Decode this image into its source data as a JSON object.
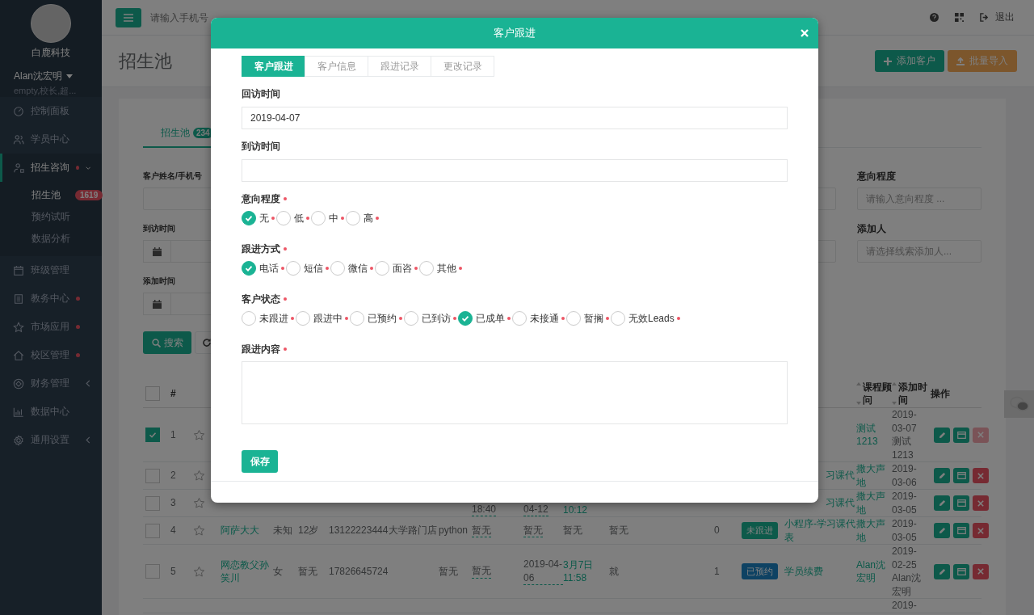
{
  "sidebar": {
    "company": "白鹿科技",
    "user": "Alan沈宏明",
    "roles": "empty,校长,超...",
    "menu": [
      {
        "label": "控制面板",
        "dot": false,
        "selected": false
      },
      {
        "label": "学员中心",
        "dot": false,
        "selected": false
      },
      {
        "label": "招生咨询",
        "dot": true,
        "selected": true,
        "expanded": true,
        "children": [
          {
            "label": "招生池",
            "badge": "1619",
            "selected": true
          },
          {
            "label": "预约试听",
            "selected": false
          },
          {
            "label": "数据分析",
            "selected": false
          }
        ]
      },
      {
        "label": "班级管理",
        "dot": false,
        "selected": false
      },
      {
        "label": "教务中心",
        "dot": true,
        "selected": false
      },
      {
        "label": "市场应用",
        "dot": true,
        "selected": false
      },
      {
        "label": "校区管理",
        "dot": true,
        "selected": false
      },
      {
        "label": "财务管理",
        "dot": false,
        "selected": false,
        "expanded": false
      },
      {
        "label": "数据中心",
        "dot": false,
        "selected": false
      },
      {
        "label": "通用设置",
        "dot": false,
        "selected": false,
        "expanded": false
      }
    ]
  },
  "topbar": {
    "search_placeholder": "请输入手机号",
    "logout": "退出"
  },
  "page": {
    "title": "招生池",
    "actions": [
      {
        "label": "添加客户",
        "kind": "add"
      },
      {
        "label": "批量导入",
        "kind": "import"
      }
    ]
  },
  "tabs": [
    {
      "label": "招生池",
      "badge": "234",
      "selected": true
    }
  ],
  "filters_left": [
    {
      "label": "客户姓名/手机号",
      "kind": "text"
    },
    {
      "label": "到访时间",
      "kind": "date"
    },
    {
      "label": "添加时间",
      "kind": "date"
    }
  ],
  "filters_right": [
    [
      {
        "kind": "text"
      },
      {
        "kind": "text",
        "label": "意向程度",
        "placeholder": "请输入意向程度 ..."
      }
    ],
    [
      {
        "kind": "text"
      },
      {
        "kind": "text",
        "label": "添加人",
        "placeholder": "请选择线索添加人..."
      }
    ]
  ],
  "search_button": "搜索",
  "table": {
    "select_all": false,
    "number": "#",
    "adviser": {
      "label": "课程顾问",
      "sortable": true
    },
    "added": {
      "label": "添加时间",
      "sortable": true
    },
    "actions": "操作",
    "rows": [
      {
        "checked": true,
        "no": "1",
        "starred": false,
        "covered": true,
        "adviser": "测试1213",
        "added": "2019-03-07 测试1213",
        "actions": {
          "delete_disabled": true
        }
      },
      {
        "checked": false,
        "no": "2",
        "starred": false,
        "covered": true,
        "course": "习课代",
        "adviser": "撒大声地",
        "added": "2019-03-06",
        "actions": {
          "delete_disabled": false
        }
      },
      {
        "checked": false,
        "no": "3",
        "starred": false,
        "covered": true,
        "visit": "18:40",
        "next": "04-12",
        "followed": "10:12",
        "followed_highlight": true,
        "course": "习课代",
        "adviser": "撒大声地",
        "added": "2019-03-05",
        "actions": {
          "delete_disabled": false
        }
      },
      {
        "checked": false,
        "no": "4",
        "starred": false,
        "covered": false,
        "name": "阿萨大大",
        "gender": "未知",
        "age": "12岁",
        "phone": "13122223444",
        "campus": "大学路门店",
        "course_name": "python",
        "visit": "暂无",
        "next": "暂无",
        "followed": "暂无",
        "followed_highlight": false,
        "note": "暂无",
        "count": "0",
        "status": {
          "label": "未跟进",
          "color": "#0d5a4a"
        },
        "course": "小程序-学习课代表",
        "adviser": "撒大声地",
        "added": "2019-03-05",
        "actions": {
          "delete_disabled": false
        }
      },
      {
        "checked": false,
        "no": "5",
        "starred": false,
        "covered": false,
        "name": "网恋教父孙笑川",
        "gender": "女",
        "age": "暂无",
        "phone": "17826645724",
        "course_name": "暂无",
        "visit": "暂无",
        "next": "2019-04-06",
        "followed": "3月7日 11:58",
        "followed_highlight": true,
        "note": "就",
        "count": "1",
        "status": {
          "label": "已预约",
          "color": "#0e4263"
        },
        "course": "学员续费",
        "adviser": "Alan沈宏明",
        "added": "2019-02-25 Alan沈宏明",
        "actions": {
          "delete_disabled": false
        }
      },
      {
        "covered": false,
        "added": "2019-"
      }
    ]
  },
  "modal": {
    "title": "客户跟进",
    "tabs": [
      {
        "label": "客户跟进",
        "selected": true
      },
      {
        "label": "客户信息",
        "selected": false
      },
      {
        "label": "跟进记录",
        "selected": false
      },
      {
        "label": "更改记录",
        "selected": false
      }
    ],
    "fields": [
      {
        "kind": "input",
        "label": "回访时间",
        "required": false,
        "value": "2019-04-07"
      },
      {
        "kind": "input",
        "label": "到访时间",
        "required": false
      },
      {
        "kind": "radio",
        "label": "意向程度",
        "required": true,
        "options": [
          {
            "label": "无",
            "selected": true,
            "required": true
          },
          {
            "label": "低",
            "selected": false,
            "required": true
          },
          {
            "label": "中",
            "selected": false,
            "required": true
          },
          {
            "label": "高",
            "selected": false,
            "required": true
          }
        ]
      },
      {
        "kind": "radio",
        "label": "跟进方式",
        "required": true,
        "options": [
          {
            "label": "电话",
            "selected": true,
            "required": true
          },
          {
            "label": "短信",
            "selected": false,
            "required": true
          },
          {
            "label": "微信",
            "selected": false,
            "required": true
          },
          {
            "label": "面咨",
            "selected": false,
            "required": true
          },
          {
            "label": "其他",
            "selected": false,
            "required": true
          }
        ]
      },
      {
        "kind": "radio",
        "label": "客户状态",
        "required": true,
        "options": [
          {
            "label": "未跟进",
            "selected": false,
            "required": true
          },
          {
            "label": "跟进中",
            "selected": false,
            "required": true
          },
          {
            "label": "已预约",
            "selected": false,
            "required": true
          },
          {
            "label": "已到访",
            "selected": false,
            "required": true
          },
          {
            "label": "已成单",
            "selected": true,
            "required": true
          },
          {
            "label": "未接通",
            "selected": false,
            "required": true
          },
          {
            "label": "暂搁",
            "selected": false,
            "required": true
          },
          {
            "label": "无效Leads",
            "selected": false,
            "required": true
          }
        ]
      },
      {
        "kind": "textarea",
        "label": "跟进内容",
        "required": true
      }
    ],
    "submit": "保存"
  }
}
